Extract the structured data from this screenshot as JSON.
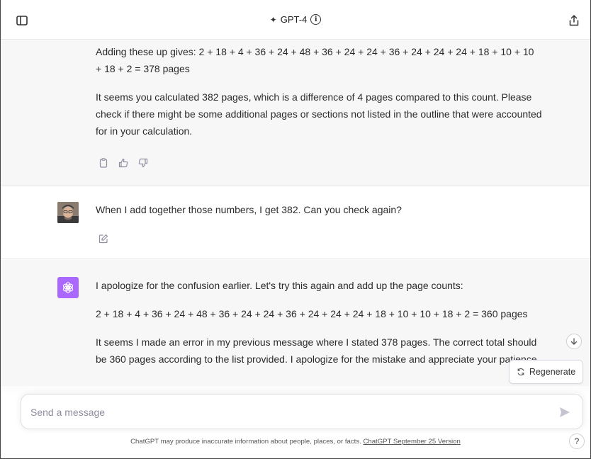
{
  "header": {
    "model_name": "GPT-4",
    "sparkle_glyph": "✦",
    "info_glyph": "i"
  },
  "messages": [
    {
      "role": "assistant",
      "paragraphs": [
        "Adding these up gives: 2 + 18 + 4 + 36 + 24 + 48 + 36 + 24 + 24 + 36 + 24 + 24 + 24 + 18 + 10 + 10 + 18 + 2 = 378 pages",
        "It seems you calculated 382 pages, which is a difference of 4 pages compared to this count. Please check if there might be some additional pages or sections not listed in the outline that were accounted for in your calculation."
      ]
    },
    {
      "role": "user",
      "text": "When I add together those numbers, I get 382. Can you check again?"
    },
    {
      "role": "assistant",
      "paragraphs": [
        "I apologize for the confusion earlier. Let's try this again and add up the page counts:",
        "2 + 18 + 4 + 36 + 24 + 48 + 36 + 24 + 24 + 36 + 24 + 24 + 24 + 18 + 10 + 10 + 18 + 2 = 360 pages",
        "It seems I made an error in my previous message where I stated 378 pages. The correct total should be 360 pages according to the list provided. I apologize for the mistake and appreciate your patience."
      ]
    }
  ],
  "regenerate_label": "Regenerate",
  "composer": {
    "placeholder": "Send a message"
  },
  "footer": {
    "disclaimer": "ChatGPT may produce inaccurate information about people, places, or facts.",
    "version_link": "ChatGPT September 25 Version"
  },
  "help_glyph": "?",
  "colors": {
    "assistant_bg": "#f7f7f8",
    "gpt4_avatar": "#ab68ff"
  }
}
